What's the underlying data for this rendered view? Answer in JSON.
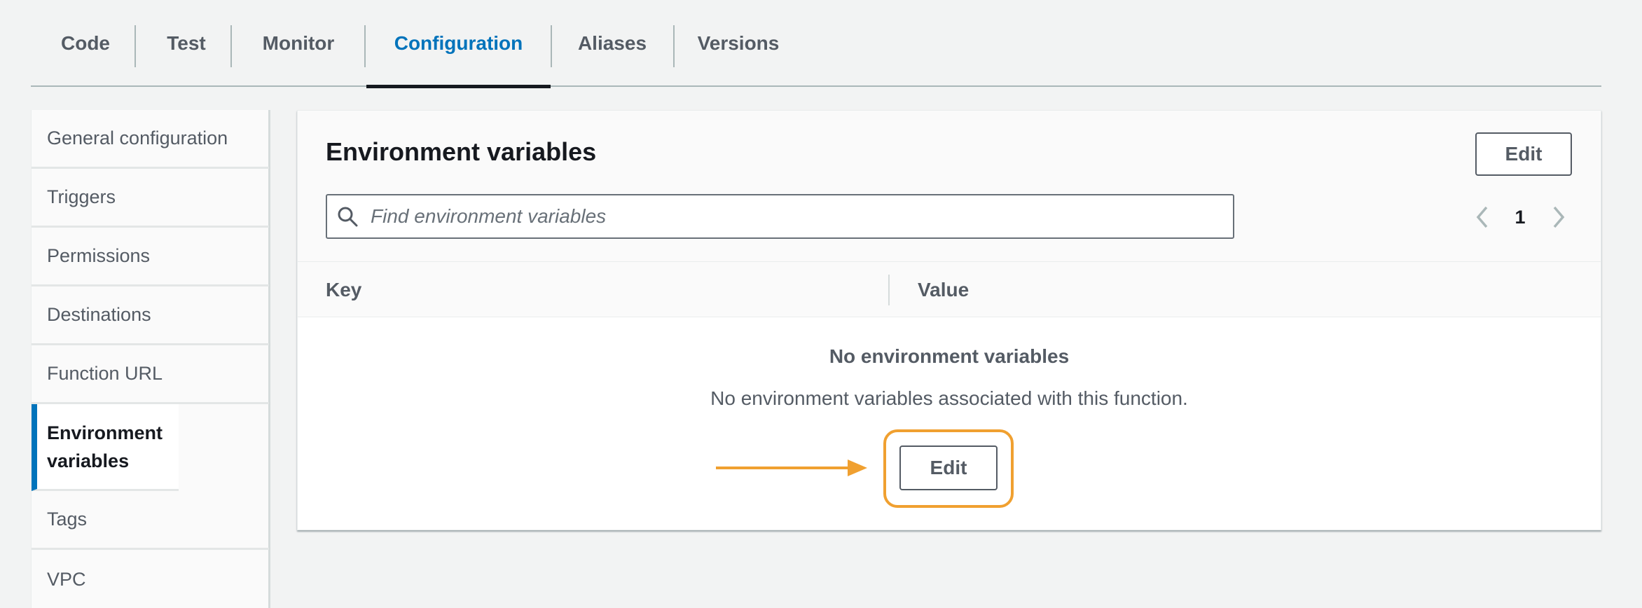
{
  "tabs": [
    {
      "label": "Code"
    },
    {
      "label": "Test"
    },
    {
      "label": "Monitor"
    },
    {
      "label": "Configuration"
    },
    {
      "label": "Aliases"
    },
    {
      "label": "Versions"
    }
  ],
  "active_tab": "Configuration",
  "sidebar": {
    "items": [
      {
        "label": "General configuration"
      },
      {
        "label": "Triggers"
      },
      {
        "label": "Permissions"
      },
      {
        "label": "Destinations"
      },
      {
        "label": "Function URL"
      },
      {
        "label": "Environment variables"
      },
      {
        "label": "Tags"
      },
      {
        "label": "VPC"
      }
    ],
    "active_item": "Environment variables"
  },
  "panel": {
    "title": "Environment variables",
    "edit_label": "Edit",
    "search": {
      "placeholder": "Find environment variables",
      "value": ""
    },
    "pagination": {
      "current_page": "1"
    },
    "table": {
      "columns": [
        "Key",
        "Value"
      ]
    },
    "empty_state": {
      "title": "No environment variables",
      "description": "No environment variables associated with this function.",
      "button_label": "Edit"
    }
  },
  "annotation": {
    "highlight_color": "#f0a030",
    "arrow_color": "#f0a030"
  },
  "colors": {
    "accent": "#0073bb",
    "text": "#16191f",
    "muted": "#545b64",
    "background": "#f2f3f3"
  },
  "icons": {
    "search": "search-icon",
    "prev": "chevron-left-icon",
    "next": "chevron-right-icon"
  }
}
